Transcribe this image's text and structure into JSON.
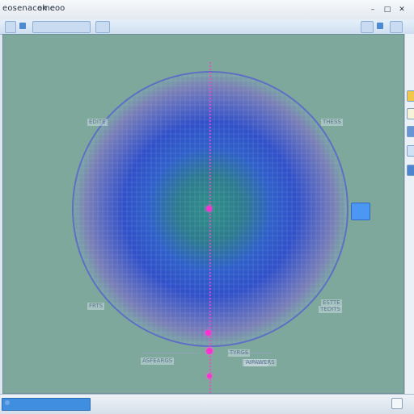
{
  "window": {
    "title": "eosenacek c",
    "title_extra": "omeoo",
    "controls": [
      "–",
      "□",
      "✕"
    ]
  },
  "viewport": {
    "background_color": "#7ea89c"
  },
  "overlay": {
    "labels": [
      {
        "text": "EDITE"
      },
      {
        "text": "THESS"
      },
      {
        "text": "FRTS"
      },
      {
        "text": "ESTTE"
      },
      {
        "text": "TEDITS"
      },
      {
        "text": "TYRGE"
      },
      {
        "text": "TYRGES"
      }
    ],
    "bottom_labels": [
      {
        "text": "ASFEARGS"
      },
      {
        "text": "AIPAWERS"
      }
    ]
  },
  "status": {
    "field_text": ""
  },
  "colors": {
    "accent": "#4d97f4",
    "marker": "#ff2fd2",
    "toolbar": "#cfdff0"
  }
}
